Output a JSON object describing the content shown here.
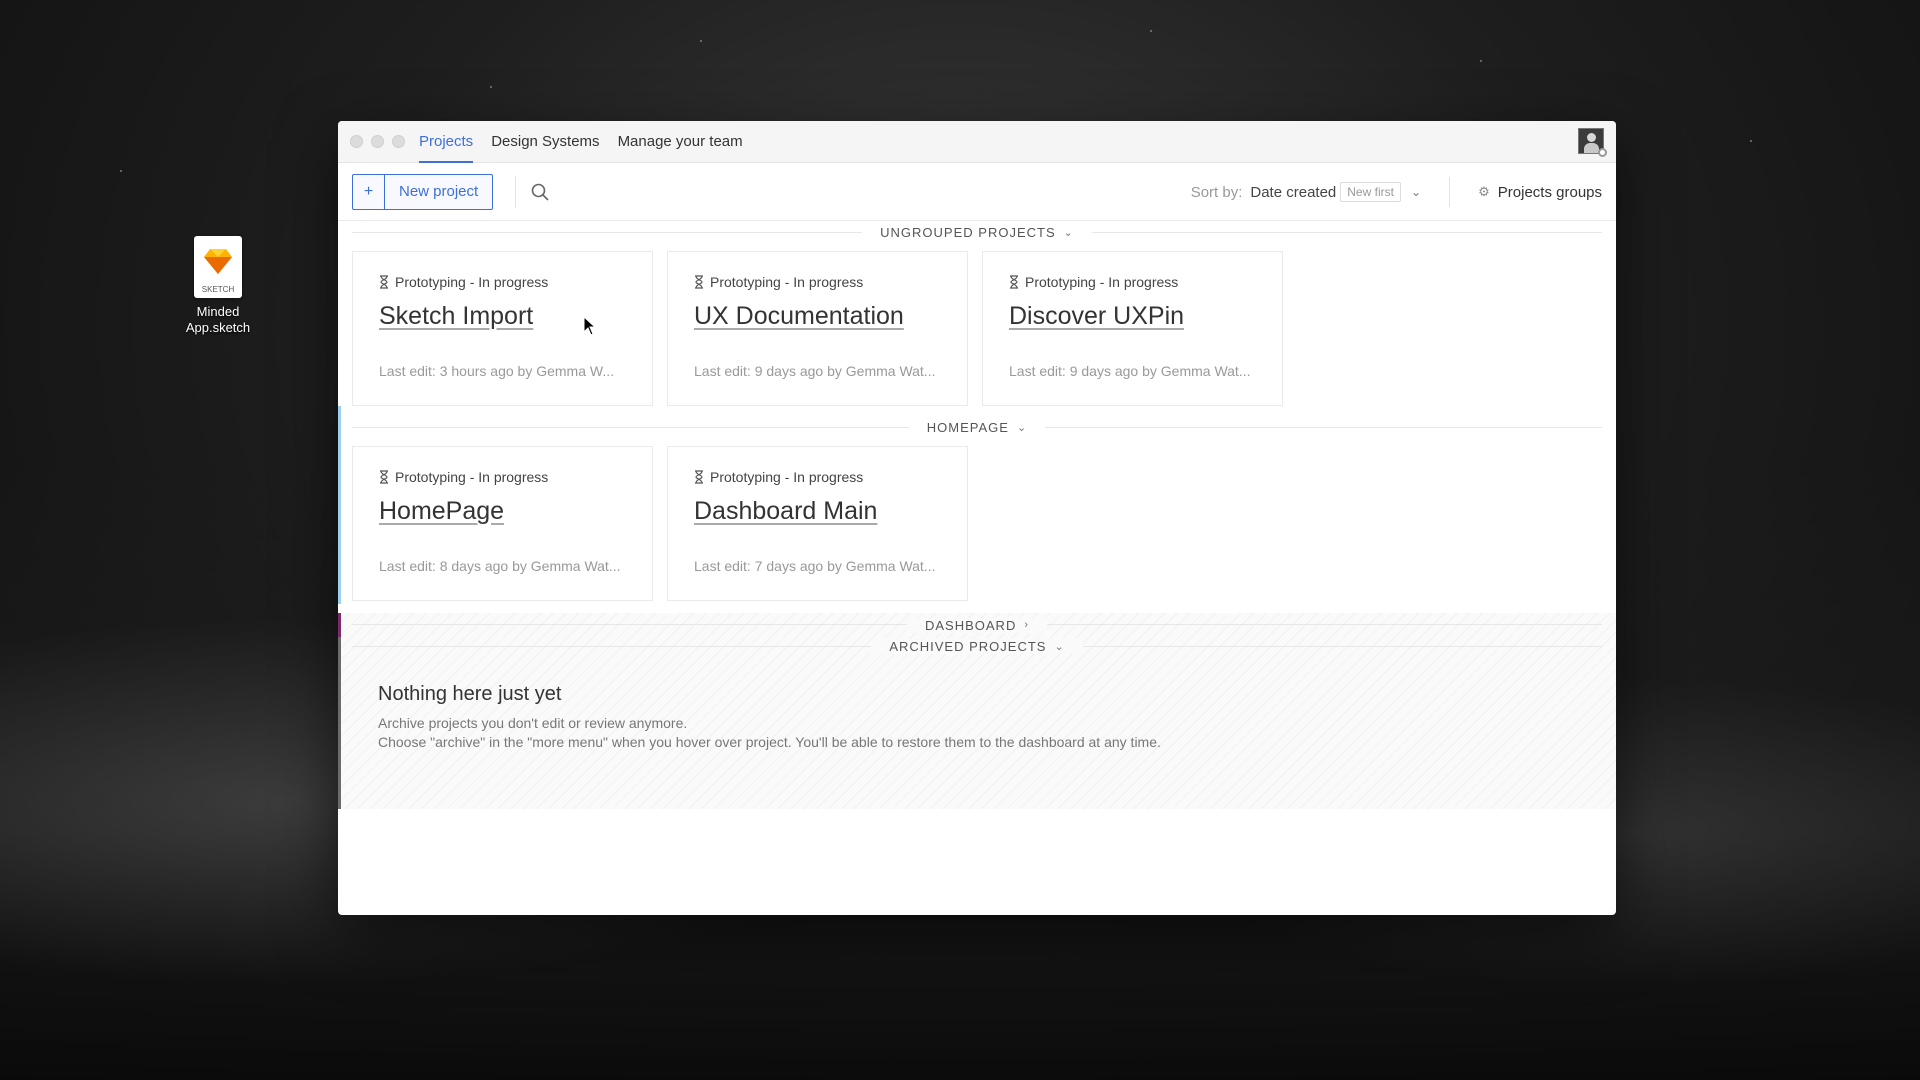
{
  "desktop": {
    "file": {
      "badge": "SKETCH",
      "name_line1": "Minded",
      "name_line2": "App.sketch"
    }
  },
  "window": {
    "tabs": [
      {
        "label": "Projects",
        "active": true
      },
      {
        "label": "Design Systems",
        "active": false
      },
      {
        "label": "Manage your team",
        "active": false
      }
    ],
    "toolbar": {
      "new_project_plus": "+",
      "new_project_label": "New project",
      "sort_label": "Sort by:",
      "sort_value": "Date created",
      "sort_order": "New first",
      "groups_label": "Projects groups"
    },
    "sections": {
      "ungrouped": "UNGROUPED PROJECTS",
      "homepage": "HOMEPAGE",
      "dashboard": "DASHBOARD",
      "archived": "ARCHIVED PROJECTS"
    },
    "ungrouped_projects": [
      {
        "status": "Prototyping - In progress",
        "title": "Sketch Import",
        "meta": "Last edit: 3 hours ago by Gemma W..."
      },
      {
        "status": "Prototyping - In progress",
        "title": "UX Documentation",
        "meta": "Last edit: 9 days ago by Gemma Wat..."
      },
      {
        "status": "Prototyping - In progress",
        "title": "Discover UXPin",
        "meta": "Last edit: 9 days ago by Gemma Wat..."
      }
    ],
    "homepage_projects": [
      {
        "status": "Prototyping - In progress",
        "title": "HomePage",
        "meta": "Last edit: 8 days ago by Gemma Wat..."
      },
      {
        "status": "Prototyping - In progress",
        "title": "Dashboard Main",
        "meta": "Last edit: 7 days ago by Gemma Wat..."
      }
    ],
    "archived_empty": {
      "heading": "Nothing here just yet",
      "line1": "Archive projects you don't edit or review anymore.",
      "line2": "Choose \"archive\" in the \"more menu\" when you hover over project. You'll be able to restore them to the dashboard at any time."
    }
  },
  "colors": {
    "accent": "#3f6fd8",
    "homepage_group": "#9bd1ef",
    "dashboard_group": "#7a2a6b"
  }
}
